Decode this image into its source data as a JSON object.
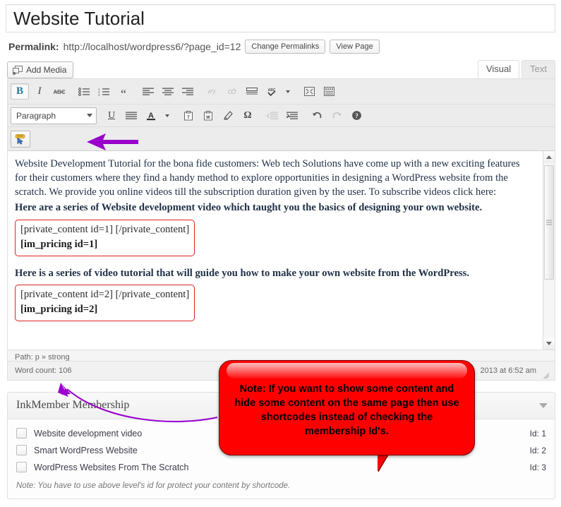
{
  "title": {
    "value": "Website Tutorial"
  },
  "permalink": {
    "label": "Permalink:",
    "url": "http://localhost/wordpress6/?page_id=12",
    "change_button": "Change Permalinks",
    "view_button": "View Page"
  },
  "media": {
    "add_media_label": "Add Media"
  },
  "editor_tabs": [
    {
      "label": "Visual",
      "active": true
    },
    {
      "label": "Text",
      "active": false
    }
  ],
  "toolbar": {
    "row1": [
      {
        "name": "bold-icon",
        "glyph": "B",
        "state": "pressed"
      },
      {
        "name": "italic-icon",
        "glyph": "I",
        "state": "normal"
      },
      {
        "name": "strikethrough-icon",
        "glyph": "ABC",
        "state": "normal"
      },
      {
        "name": "unordered-list-icon",
        "glyph": "",
        "state": "normal"
      },
      {
        "name": "ordered-list-icon",
        "glyph": "",
        "state": "normal"
      },
      {
        "name": "blockquote-icon",
        "glyph": "“",
        "state": "normal"
      },
      {
        "name": "align-left-icon",
        "glyph": "",
        "state": "normal"
      },
      {
        "name": "align-center-icon",
        "glyph": "",
        "state": "normal"
      },
      {
        "name": "align-right-icon",
        "glyph": "",
        "state": "normal"
      },
      {
        "name": "insert-link-icon",
        "glyph": "",
        "state": "disabled"
      },
      {
        "name": "unlink-icon",
        "glyph": "",
        "state": "disabled"
      },
      {
        "name": "insert-more-tag-icon",
        "glyph": "",
        "state": "normal"
      },
      {
        "name": "spellcheck-icon",
        "glyph": "ABC",
        "state": "normal"
      },
      {
        "name": "spellcheck-dropdown-icon",
        "glyph": "",
        "state": "normal"
      },
      {
        "name": "fullscreen-icon",
        "glyph": "",
        "state": "normal"
      },
      {
        "name": "kitchen-sink-icon",
        "glyph": "",
        "state": "normal"
      }
    ],
    "format_select": "Paragraph",
    "row2": [
      {
        "name": "underline-icon",
        "glyph": "U",
        "state": "normal"
      },
      {
        "name": "align-justify-icon",
        "glyph": "",
        "state": "normal"
      },
      {
        "name": "text-color-icon",
        "glyph": "A",
        "state": "normal"
      },
      {
        "name": "text-color-dropdown-icon",
        "glyph": "",
        "state": "normal"
      },
      {
        "name": "paste-as-text-icon",
        "glyph": "",
        "state": "normal"
      },
      {
        "name": "paste-from-word-icon",
        "glyph": "",
        "state": "normal"
      },
      {
        "name": "remove-formatting-icon",
        "glyph": "",
        "state": "normal"
      },
      {
        "name": "special-character-icon",
        "glyph": "Ω",
        "state": "normal"
      },
      {
        "name": "outdent-icon",
        "glyph": "",
        "state": "disabled"
      },
      {
        "name": "indent-icon",
        "glyph": "",
        "state": "normal"
      },
      {
        "name": "undo-icon",
        "glyph": "",
        "state": "normal"
      },
      {
        "name": "redo-icon",
        "glyph": "",
        "state": "disabled"
      },
      {
        "name": "help-icon",
        "glyph": "?",
        "state": "normal"
      }
    ],
    "row3": [
      {
        "name": "inkmember-shortcode-icon",
        "state": "normal"
      }
    ]
  },
  "content": {
    "paragraph1": "Website Development Tutorial for the bona fide customers: Web tech Solutions have come up with a new exciting features for their customers where they find a handy method to explore opportunities in designing a WordPress website from the scratch. We provide you online videos till the subscription duration given by the user. To subscribe videos click here:",
    "heading1": "Here are a series of Website development video which taught you the basics of designing your own website.",
    "shortcode_block_1_line1": "[private_content id=1] [/private_content]",
    "shortcode_block_1_line2": "[im_pricing id=1]",
    "heading2": "Here is a series of video tutorial that will guide you how to make your own website from the WordPress.",
    "shortcode_block_2_line1": "[private_content id=2] [/private_content]",
    "shortcode_block_2_line2": "[im_pricing id=2]"
  },
  "status": {
    "path": "Path: p » strong",
    "word_count": "Word count: 106",
    "last_edited": "2013 at 6:52 am"
  },
  "callout": {
    "text": "Note: If you want to show some content and hide some content on the same page then use shortcodes instead of checking the membership Id's."
  },
  "metabox": {
    "title": "InkMember Membership",
    "rows": [
      {
        "label": "Website development video",
        "id_label": "Id: 1",
        "checked": false
      },
      {
        "label": "Smart WordPress Website",
        "id_label": "Id: 2",
        "checked": false
      },
      {
        "label": "WordPress Websites From The Scratch",
        "id_label": "Id: 3",
        "checked": false
      }
    ],
    "note": "Note: You have to use above level's id for protect your content by shortcode."
  },
  "colors": {
    "callout_red": "#fe0000",
    "shortcode_border": "#dd2222",
    "annotation_purple": "#9900cc",
    "accent_bold_blue": "#21759b"
  }
}
